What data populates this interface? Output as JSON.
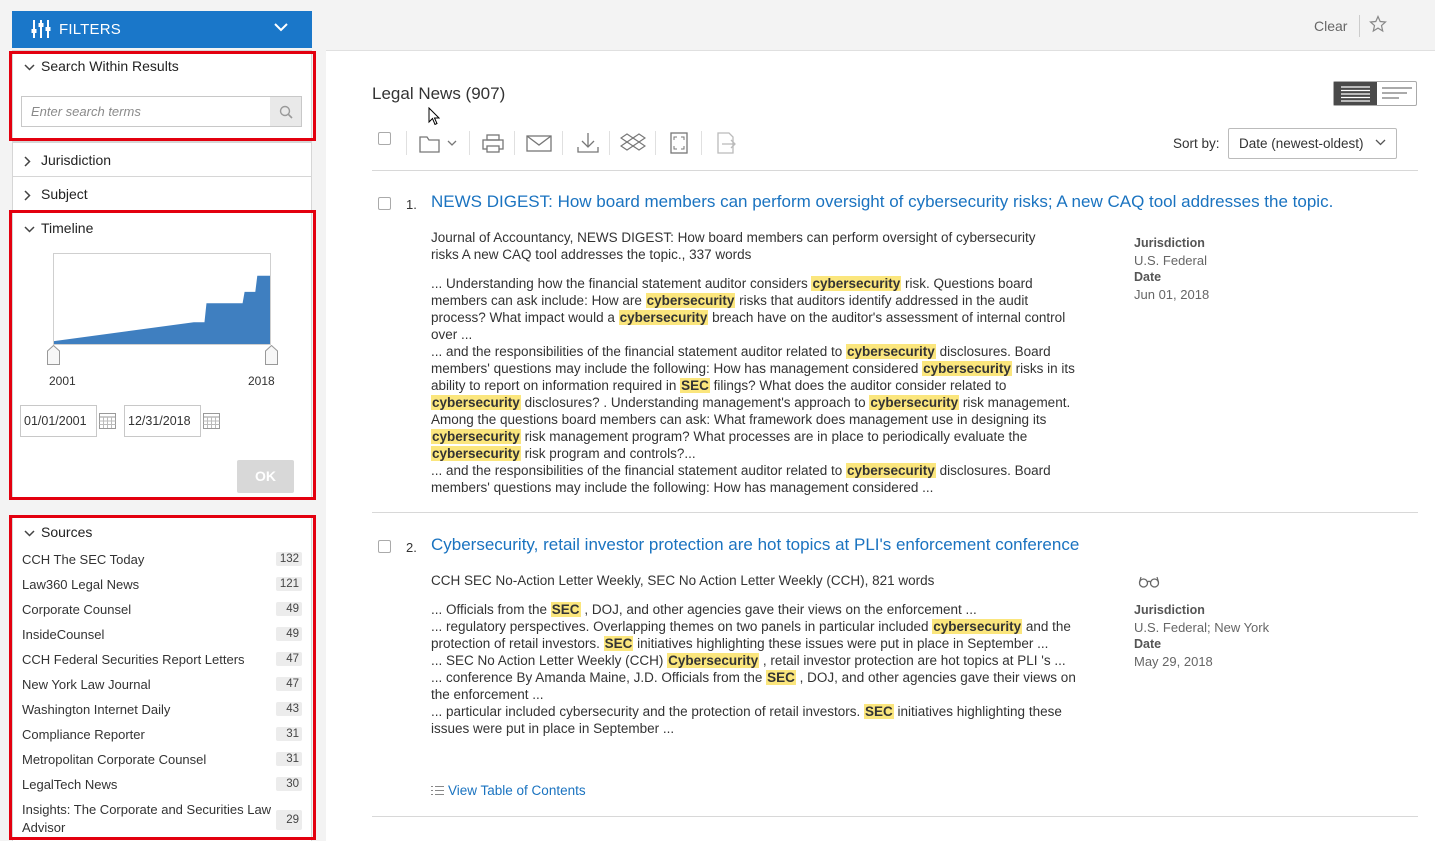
{
  "sidebar": {
    "filters_label": "FILTERS",
    "search_within": {
      "title": "Search Within Results",
      "placeholder": "Enter search terms"
    },
    "jurisdiction_label": "Jurisdiction",
    "subject_label": "Subject",
    "timeline": {
      "title": "Timeline",
      "start_year": "2001",
      "end_year": "2018",
      "from_date": "01/01/2001",
      "to_date": "12/31/2018",
      "ok_label": "OK"
    },
    "sources": {
      "title": "Sources",
      "items": [
        {
          "name": "CCH The SEC Today",
          "count": "132"
        },
        {
          "name": "Law360 Legal News",
          "count": "121"
        },
        {
          "name": "Corporate Counsel",
          "count": "49"
        },
        {
          "name": "InsideCounsel",
          "count": "49"
        },
        {
          "name": "CCH Federal Securities Report Letters",
          "count": "47"
        },
        {
          "name": "New York Law Journal",
          "count": "47"
        },
        {
          "name": "Washington Internet Daily",
          "count": "43"
        },
        {
          "name": "Compliance Reporter",
          "count": "31"
        },
        {
          "name": "Metropolitan Corporate Counsel",
          "count": "31"
        },
        {
          "name": "LegalTech News",
          "count": "30"
        },
        {
          "name": "Insights: The Corporate and Securities Law Advisor",
          "count": "29"
        }
      ]
    }
  },
  "header": {
    "clear_label": "Clear",
    "star_icon": "star-icon"
  },
  "results": {
    "title": "Legal News (907)",
    "sort_label": "Sort by:",
    "sort_value": "Date (newest-oldest)",
    "toolbar_icons": [
      "checkbox",
      "folder-icon",
      "print-icon",
      "email-icon",
      "download-icon",
      "dropbox-icon",
      "fullscreen-icon",
      "export-icon"
    ],
    "items": [
      {
        "num": "1.",
        "title": "NEWS DIGEST: How board members can perform oversight of cybersecurity risks; A new CAQ tool addresses the topic.",
        "meta_line1": "Journal of Accountancy, NEWS DIGEST: How board members can perform oversight of cybersecurity",
        "meta_line2": "risks A new CAQ tool addresses the topic., 337 words",
        "jurisdiction_label": "Jurisdiction",
        "jurisdiction": "U.S. Federal",
        "date_label": "Date",
        "date": "Jun 01, 2018"
      },
      {
        "num": "2.",
        "title": "Cybersecurity, retail investor protection are hot topics at PLI's enforcement conference",
        "meta_line1": "CCH SEC No-Action Letter Weekly, SEC No Action Letter Weekly (CCH), 821 words",
        "jurisdiction_label": "Jurisdiction",
        "jurisdiction": "U.S. Federal; New York",
        "date_label": "Date",
        "date": "May 29, 2018",
        "toc_label": "View Table of Contents"
      }
    ]
  },
  "timeline_chart_data": {
    "type": "area",
    "x": [
      2001,
      2012,
      2013,
      2016,
      2017,
      2018
    ],
    "y": [
      3,
      23,
      43,
      55,
      72,
      72
    ],
    "ylim": [
      0,
      95
    ]
  }
}
